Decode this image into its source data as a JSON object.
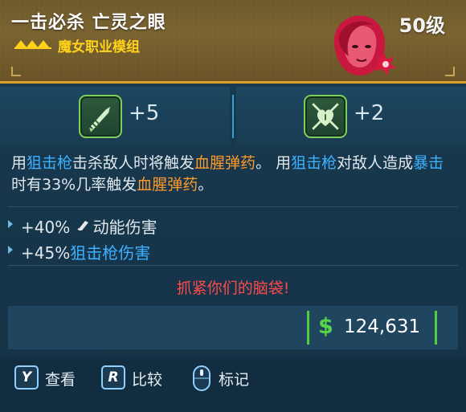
{
  "item": {
    "title": "一击必杀 亡灵之眼",
    "level": "50级",
    "subtitle": "魔女职业模组",
    "colors": {
      "header": "#6e5a2c",
      "accent": "#ffd21a",
      "border": "#d9a227"
    }
  },
  "skills": [
    {
      "icon": "sniper-bullet-icon",
      "value": "+5"
    },
    {
      "icon": "heart-crosshair-icon",
      "value": "+2"
    }
  ],
  "description": {
    "s1": "用",
    "s2": "狙击枪",
    "s3": "击杀敌人时将触发",
    "s4": "血腥弹药",
    "s5": "。 用",
    "s6": "狙击枪",
    "s7": "对敌人造成",
    "s8": "暴击",
    "s9": "时有33%几率触发",
    "s10": "血腥弹药",
    "s11": "。"
  },
  "stats": [
    {
      "value": "+40%",
      "label": "动能伤害",
      "icon": "kinetic-element-icon"
    },
    {
      "value": "+45%",
      "label": "狙击枪伤害"
    }
  ],
  "flavor_text": "抓紧你们的脑袋!",
  "price": {
    "currency": "$",
    "amount": "124,631"
  },
  "footer": {
    "view": {
      "key": "Y",
      "label": "查看"
    },
    "compare": {
      "key": "R",
      "label": "比较"
    },
    "mark": {
      "label": "标记"
    }
  }
}
